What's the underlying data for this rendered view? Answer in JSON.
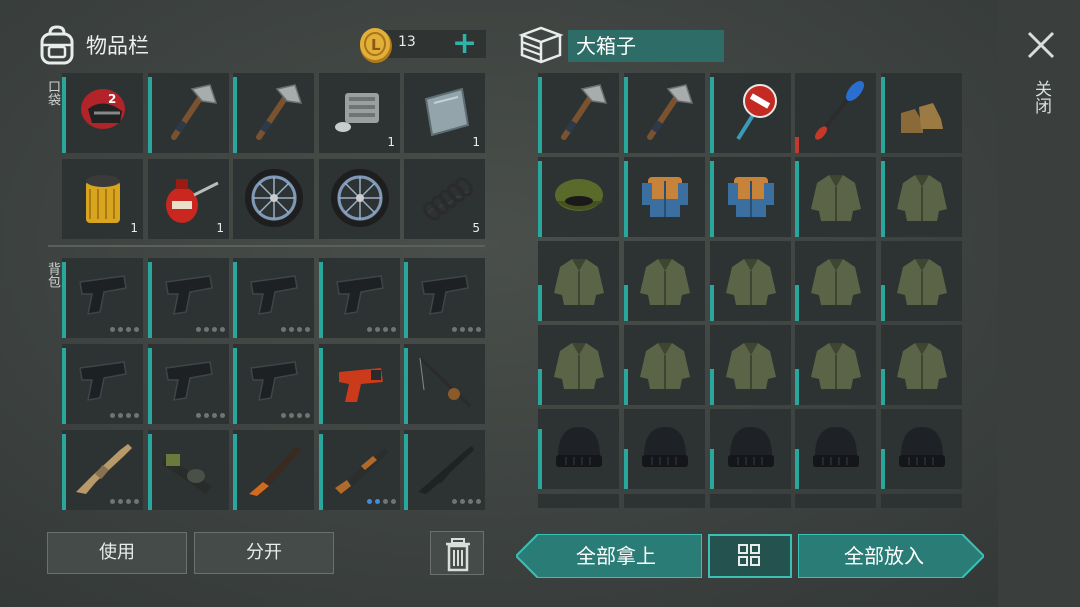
{
  "inventory": {
    "title": "物品栏",
    "coins": "13",
    "plus": "+",
    "pocket_label": "口袋",
    "backpack_label": "背包",
    "pocket_slots": [
      {
        "icon": "helmet-icon",
        "qty": ""
      },
      {
        "icon": "hatchet-icon",
        "qty": ""
      },
      {
        "icon": "hatchet-icon",
        "qty": ""
      },
      {
        "icon": "engine-block-icon",
        "qty": "1"
      },
      {
        "icon": "metal-plate-icon",
        "qty": "1"
      },
      {
        "icon": "oil-filter-icon",
        "qty": "1"
      },
      {
        "icon": "oil-can-icon",
        "qty": "1"
      },
      {
        "icon": "wheel-icon",
        "qty": ""
      },
      {
        "icon": "wheel-icon",
        "qty": ""
      },
      {
        "icon": "spring-icon",
        "qty": "5"
      }
    ],
    "backpack_slots": [
      {
        "icon": "pistol-icon"
      },
      {
        "icon": "pistol-icon"
      },
      {
        "icon": "pistol-icon"
      },
      {
        "icon": "pistol-icon"
      },
      {
        "icon": "pistol-icon"
      },
      {
        "icon": "pistol-icon"
      },
      {
        "icon": "pistol-icon"
      },
      {
        "icon": "pistol-icon"
      },
      {
        "icon": "flare-gun-icon"
      },
      {
        "icon": "fishing-rod-icon"
      },
      {
        "icon": "assault-rifle-icon"
      },
      {
        "icon": "grenade-launcher-icon"
      },
      {
        "icon": "hunting-rifle-icon"
      },
      {
        "icon": "shotgun-icon"
      },
      {
        "icon": "rifle-icon"
      }
    ]
  },
  "box": {
    "title": "大箱子",
    "slots": [
      {
        "icon": "hatchet-icon"
      },
      {
        "icon": "hatchet-icon"
      },
      {
        "icon": "stop-sign-icon"
      },
      {
        "icon": "paddle-icon"
      },
      {
        "icon": "boots-icon"
      },
      {
        "icon": "camo-cap-icon"
      },
      {
        "icon": "vest-icon"
      },
      {
        "icon": "vest-icon"
      },
      {
        "icon": "jacket-icon"
      },
      {
        "icon": "jacket-icon"
      },
      {
        "icon": "jacket-icon"
      },
      {
        "icon": "jacket-icon"
      },
      {
        "icon": "jacket-icon"
      },
      {
        "icon": "jacket-icon"
      },
      {
        "icon": "jacket-icon"
      },
      {
        "icon": "jacket-icon"
      },
      {
        "icon": "jacket-icon"
      },
      {
        "icon": "jacket-icon"
      },
      {
        "icon": "jacket-icon"
      },
      {
        "icon": "jacket-icon"
      },
      {
        "icon": "beanie-icon"
      },
      {
        "icon": "beanie-icon"
      },
      {
        "icon": "beanie-icon"
      },
      {
        "icon": "beanie-icon"
      },
      {
        "icon": "beanie-icon"
      }
    ]
  },
  "close_label": "关闭",
  "buttons": {
    "use": "使用",
    "split": "分开",
    "take_all": "全部拿上",
    "put_all": "全部放入"
  },
  "colors": {
    "accent": "#2aa79c",
    "slot_bg": "#2d3232",
    "title_bg": "#2e6d67",
    "durability_low": "#c23a2e"
  }
}
